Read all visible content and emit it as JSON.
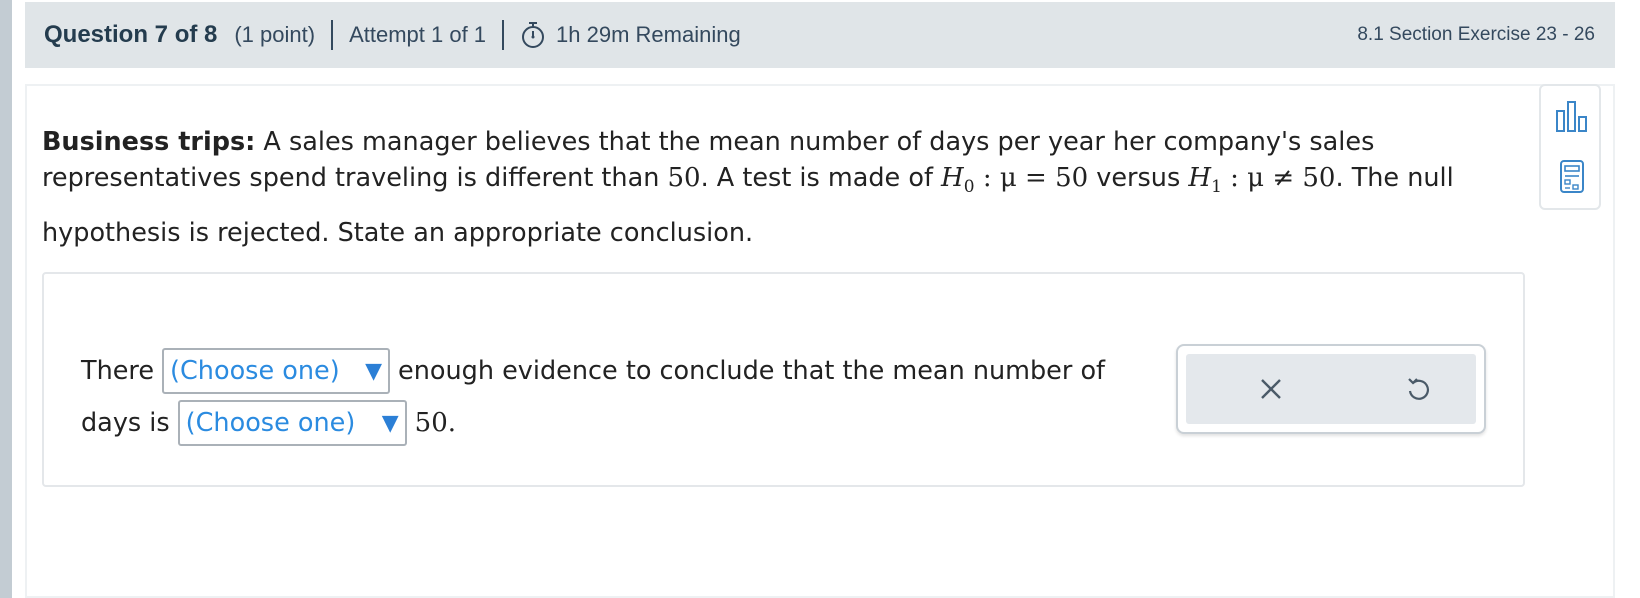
{
  "header": {
    "question_title": "Question 7 of 8",
    "points": "(1 point)",
    "attempt": "Attempt 1 of 1",
    "remaining": "1h 29m Remaining",
    "section": "8.1 Section Exercise 23 - 26"
  },
  "question": {
    "topic": "Business trips:",
    "text_a": " A sales manager believes that the mean number of days per year her company's sales",
    "text_b": "representatives spend traveling is different than ",
    "value_50": "50",
    "text_c": ". A test is made of ",
    "h0": "H",
    "h0_sub": "0",
    "h0_rest": " : μ = 50",
    "versus": " versus ",
    "h1": "H",
    "h1_sub": "1",
    "h1_rest": " : μ ≠ 50",
    "text_d": ". The null",
    "text_e": "hypothesis is rejected. State an appropriate conclusion."
  },
  "answer": {
    "there": "There",
    "select1": "(Choose one)",
    "middle": "enough evidence to conclude that the mean number of",
    "days_is": "days is",
    "select2": "(Choose one)",
    "end": "50."
  },
  "icons": {
    "timer": "stopwatch-icon",
    "stats": "statistics-icon",
    "calc": "calculator-icon",
    "clear": "close-icon",
    "undo": "undo-icon",
    "caret": "triangle-down-icon"
  },
  "colors": {
    "header_bg": "#e0e5e8",
    "select_text": "#2b8be0",
    "tool_blue": "#3b86c8",
    "header_text": "#243c4e"
  }
}
